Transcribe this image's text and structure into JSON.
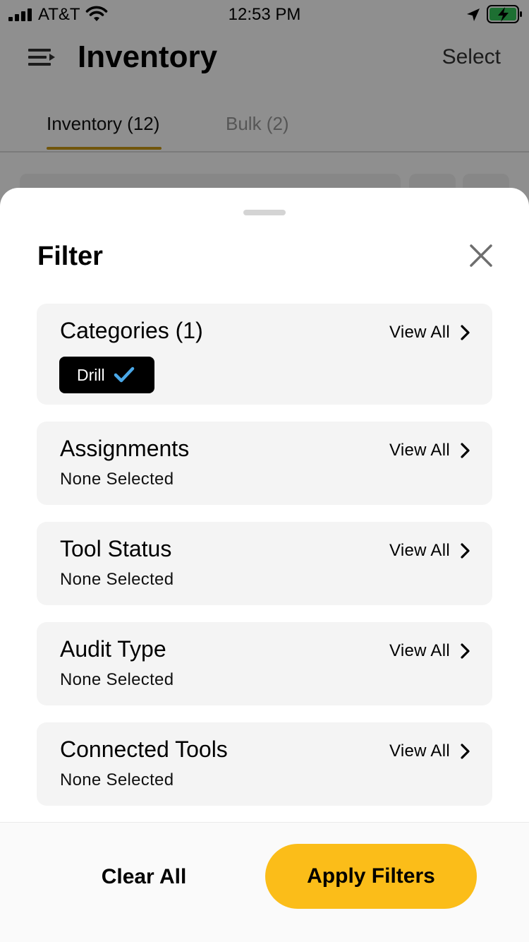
{
  "status_bar": {
    "carrier": "AT&T",
    "time": "12:53 PM",
    "battery_color": "#35c759"
  },
  "header": {
    "title": "Inventory",
    "select_label": "Select",
    "menu_icon": "menu-icon"
  },
  "tabs": [
    {
      "label": "Inventory (12)",
      "active": true
    },
    {
      "label": "Bulk (2)",
      "active": false
    }
  ],
  "colors": {
    "accent": "#fbbd19",
    "tab_underline": "#c99a16",
    "chip_bg": "#000000",
    "check": "#4aa8e8"
  },
  "filter_sheet": {
    "title": "Filter",
    "close_icon": "close-icon",
    "sections": [
      {
        "title": "Categories (1)",
        "view_all": "View All",
        "chip": "Drill"
      },
      {
        "title": "Assignments",
        "view_all": "View All",
        "subtitle": "None Selected"
      },
      {
        "title": "Tool Status",
        "view_all": "View All",
        "subtitle": "None Selected"
      },
      {
        "title": "Audit Type",
        "view_all": "View All",
        "subtitle": "None Selected"
      },
      {
        "title": "Connected Tools",
        "view_all": "View All",
        "subtitle": "None Selected"
      }
    ],
    "clear_all_label": "Clear All",
    "apply_label": "Apply Filters"
  }
}
